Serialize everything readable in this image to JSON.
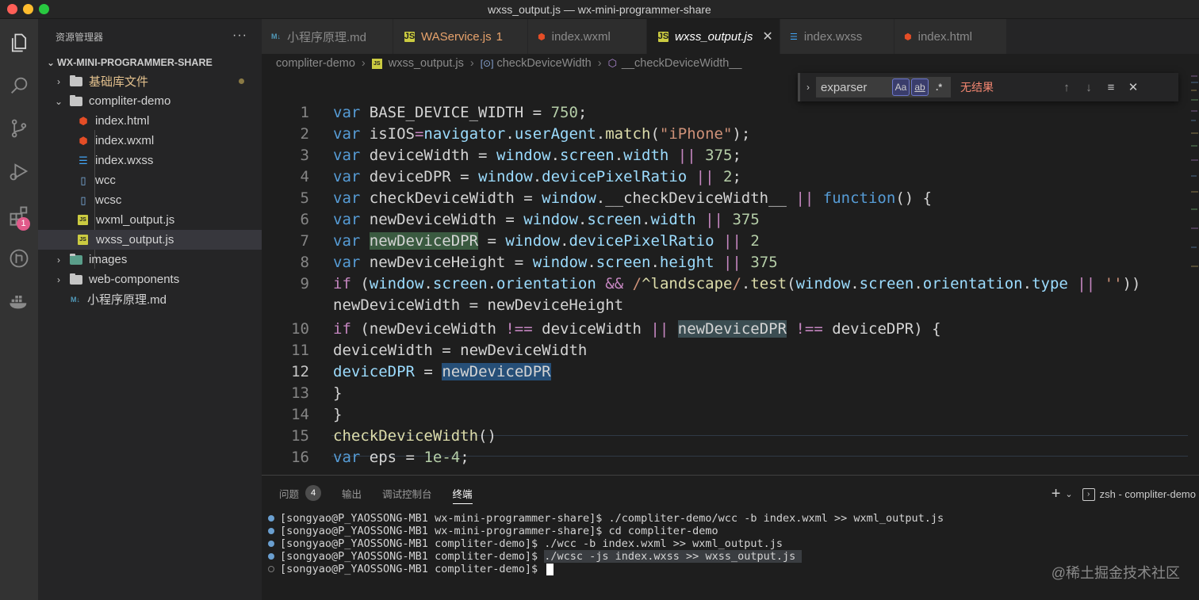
{
  "window": {
    "title": "wxss_output.js — wx-mini-programmer-share"
  },
  "activity": {
    "extensions_badge": "1"
  },
  "sidebar": {
    "title": "资源管理器",
    "more": "···",
    "section": "WX-MINI-PROGRAMMER-SHARE",
    "items": [
      {
        "label": "基础库文件"
      },
      {
        "label": "compliter-demo"
      },
      {
        "label": "index.html"
      },
      {
        "label": "index.wxml"
      },
      {
        "label": "index.wxss"
      },
      {
        "label": "wcc"
      },
      {
        "label": "wcsc"
      },
      {
        "label": "wxml_output.js"
      },
      {
        "label": "wxss_output.js"
      },
      {
        "label": "images"
      },
      {
        "label": "web-components"
      },
      {
        "label": "小程序原理.md"
      }
    ]
  },
  "tabs": [
    {
      "label": "小程序原理.md",
      "icon": "M↓"
    },
    {
      "label": "WAService.js",
      "badge": "1",
      "icon": "JS"
    },
    {
      "label": "index.wxml",
      "icon": "5"
    },
    {
      "label": "wxss_output.js",
      "icon": "JS",
      "close": "✕"
    },
    {
      "label": "index.wxss",
      "icon": "3"
    },
    {
      "label": "index.html",
      "icon": "5"
    }
  ],
  "breadcrumb": {
    "folder": "compliter-demo",
    "file": "wxss_output.js",
    "symbol1": "checkDeviceWidth",
    "symbol2": "__checkDeviceWidth__"
  },
  "find": {
    "value": "exparser",
    "opt_case": "Aa",
    "opt_word": "ab",
    "opt_regex": ".*",
    "result": "无结果"
  },
  "editor": {
    "line_numbers": [
      "1",
      "2",
      "3",
      "4",
      "5",
      "6",
      "7",
      "8",
      "9",
      "",
      "10",
      "11",
      "12",
      "13",
      "14",
      "15",
      "16"
    ],
    "current_line": "12"
  },
  "panel": {
    "tabs": [
      "问题",
      "输出",
      "调试控制台",
      "终端"
    ],
    "problems_count": "4",
    "terminal_name": "zsh - compliter-demo",
    "lines": [
      "[songyao@P_YAOSSONG-MB1 wx-mini-programmer-share]$ ./compliter-demo/wcc -b index.wxml >> wxml_output.js",
      "[songyao@P_YAOSSONG-MB1 wx-mini-programmer-share]$ cd compliter-demo",
      "[songyao@P_YAOSSONG-MB1 compliter-demo]$ ./wcc -b index.wxml >> wxml_output.js",
      "[songyao@P_YAOSSONG-MB1 compliter-demo]$ ",
      "[songyao@P_YAOSSONG-MB1 compliter-demo]$ "
    ],
    "selected_command": "./wcsc -js index.wxss >> wxss_output.js "
  },
  "watermark": "@稀土掘金技术社区",
  "colors": {
    "keyword": "#c586c0",
    "storage": "#569cd6",
    "property": "#9cdcfe",
    "number": "#b5cea8",
    "function": "#dcdcaa",
    "string": "#ce9178",
    "find_no_result": "#f48771"
  }
}
